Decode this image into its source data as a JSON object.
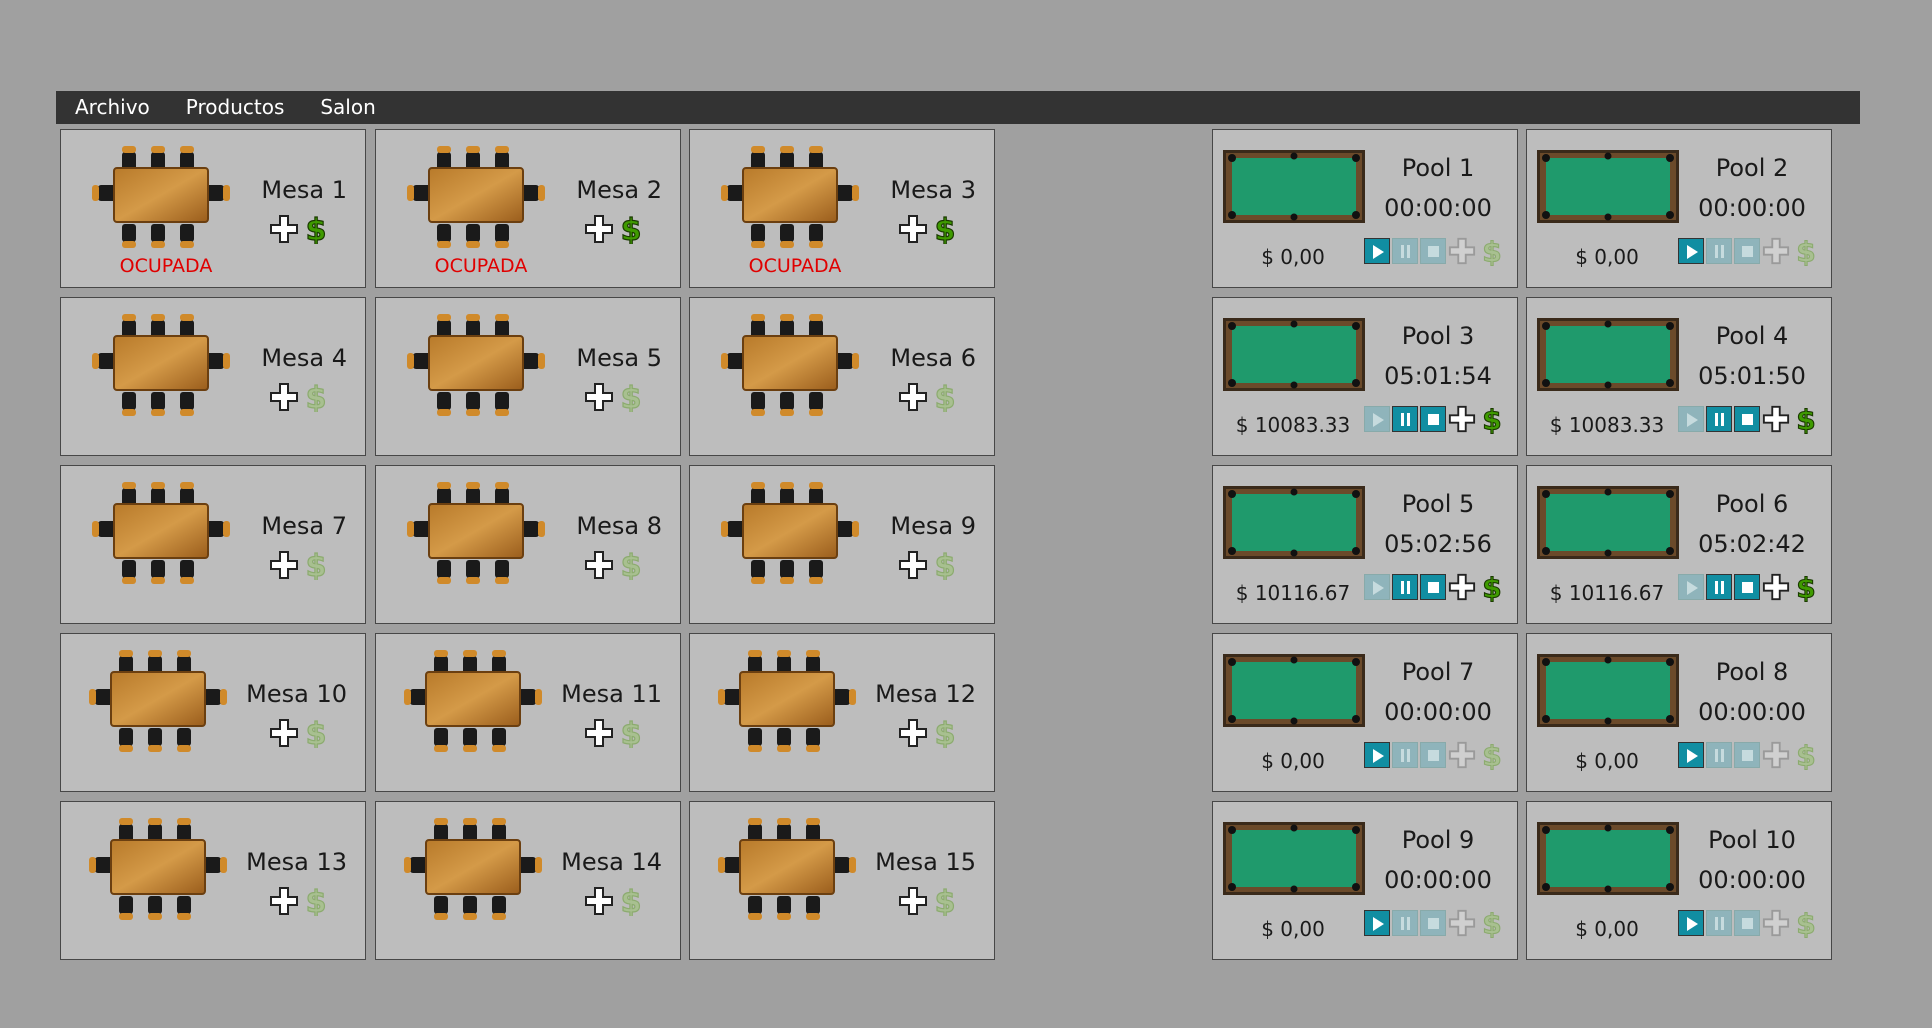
{
  "menu": [
    "Archivo",
    "Productos",
    "Salon"
  ],
  "mesas": [
    {
      "name": "Mesa 1",
      "status": "OCUPADA",
      "active": true
    },
    {
      "name": "Mesa 2",
      "status": "OCUPADA",
      "active": true
    },
    {
      "name": "Mesa 3",
      "status": "OCUPADA",
      "active": true
    },
    {
      "name": "Mesa 4",
      "status": "",
      "active": false
    },
    {
      "name": "Mesa 5",
      "status": "",
      "active": false
    },
    {
      "name": "Mesa 6",
      "status": "",
      "active": false
    },
    {
      "name": "Mesa 7",
      "status": "",
      "active": false
    },
    {
      "name": "Mesa 8",
      "status": "",
      "active": false
    },
    {
      "name": "Mesa 9",
      "status": "",
      "active": false
    },
    {
      "name": "Mesa 10",
      "status": "",
      "active": false
    },
    {
      "name": "Mesa 11",
      "status": "",
      "active": false
    },
    {
      "name": "Mesa 12",
      "status": "",
      "active": false
    },
    {
      "name": "Mesa 13",
      "status": "",
      "active": false
    },
    {
      "name": "Mesa 14",
      "status": "",
      "active": false
    },
    {
      "name": "Mesa 15",
      "status": "",
      "active": false
    }
  ],
  "pools": [
    {
      "name": "Pool 1",
      "time": "00:00:00",
      "price": "$ 0,00",
      "running": false
    },
    {
      "name": "Pool 2",
      "time": "00:00:00",
      "price": "$ 0,00",
      "running": false
    },
    {
      "name": "Pool 3",
      "time": "05:01:54",
      "price": "$ 10083.33",
      "running": true
    },
    {
      "name": "Pool 4",
      "time": "05:01:50",
      "price": "$ 10083.33",
      "running": true
    },
    {
      "name": "Pool 5",
      "time": "05:02:56",
      "price": "$ 10116.67",
      "running": true
    },
    {
      "name": "Pool 6",
      "time": "05:02:42",
      "price": "$ 10116.67",
      "running": true
    },
    {
      "name": "Pool 7",
      "time": "00:00:00",
      "price": "$ 0,00",
      "running": false
    },
    {
      "name": "Pool 8",
      "time": "00:00:00",
      "price": "$ 0,00",
      "running": false
    },
    {
      "name": "Pool 9",
      "time": "00:00:00",
      "price": "$ 0,00",
      "running": false
    },
    {
      "name": "Pool 10",
      "time": "00:00:00",
      "price": "$ 0,00",
      "running": false
    }
  ],
  "icons": {
    "add": "plus-icon",
    "pay": "dollar-icon",
    "play": "play-icon",
    "pause": "pause-icon",
    "stop": "stop-icon"
  },
  "colors": {
    "occupied_text": "#e00000",
    "dollar_active": "#3f9b00",
    "dollar_inactive": "#8cab6f",
    "ctrl_active": "#118ea2",
    "felt": "#1f9a6c"
  }
}
